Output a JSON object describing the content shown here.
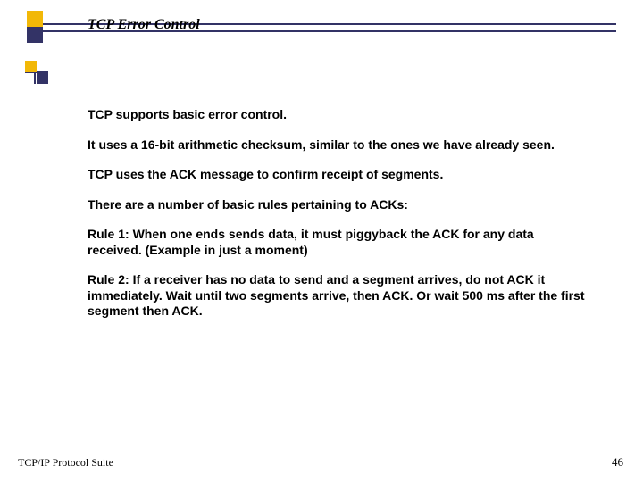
{
  "slide": {
    "title": "TCP Error Control",
    "paragraphs": [
      "TCP supports basic error control.",
      "It uses a 16-bit arithmetic checksum, similar to the ones we have already seen.",
      "TCP uses the ACK message to confirm receipt of segments.",
      "There are a number of basic rules pertaining to ACKs:",
      "Rule 1: When one ends sends data, it must piggyback the ACK for any data received.  (Example in just a moment)",
      "Rule 2: If a receiver has no data to send and a segment arrives, do not ACK it immediately.  Wait until two segments arrive, then ACK.  Or wait 500 ms after the first segment then ACK."
    ]
  },
  "footer": {
    "left": "TCP/IP Protocol Suite",
    "page": "46"
  }
}
